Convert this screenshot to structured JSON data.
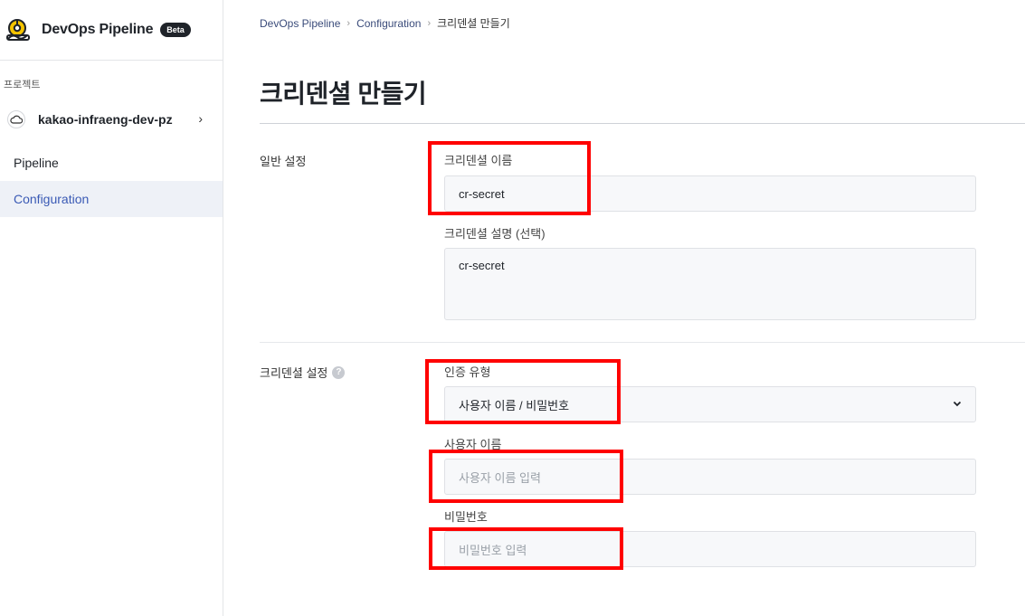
{
  "app": {
    "title": "DevOps Pipeline",
    "badge": "Beta"
  },
  "sidebar": {
    "section_label": "프로젝트",
    "project": {
      "name": "kakao-infraeng-dev-pz",
      "chevron": "›"
    },
    "items": [
      {
        "label": "Pipeline",
        "active": false
      },
      {
        "label": "Configuration",
        "active": true
      }
    ]
  },
  "breadcrumb": {
    "items": [
      "DevOps Pipeline",
      "Configuration",
      "크리덴셜 만들기"
    ],
    "separator": "›"
  },
  "page": {
    "title": "크리덴셜 만들기"
  },
  "general": {
    "label": "일반 설정",
    "name_label": "크리덴셜 이름",
    "name_value": "cr-secret",
    "desc_label": "크리덴셜 설명 (선택)",
    "desc_value": "cr-secret"
  },
  "credential": {
    "label": "크리덴셜 설정",
    "help_icon": "question-icon",
    "auth_label": "인증 유형",
    "auth_value": "사용자 이름 / 비밀번호",
    "username_label": "사용자 이름",
    "username_placeholder": "사용자 이름 입력",
    "password_label": "비밀번호",
    "password_placeholder": "비밀번호 입력"
  },
  "colors": {
    "accent": "#3a5ab5",
    "active_bg": "#eef1f7",
    "highlight": "#ff0000",
    "logo_yellow": "#f5c400"
  }
}
